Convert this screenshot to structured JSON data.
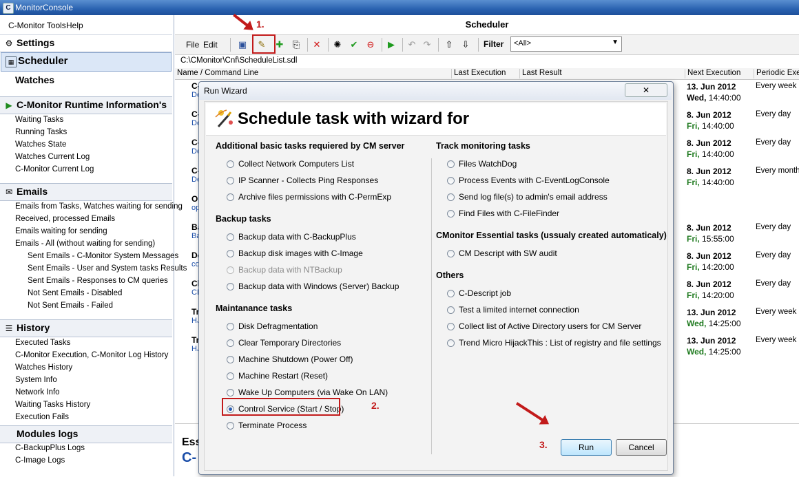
{
  "window": {
    "title": "MonitorConsole"
  },
  "menu": {
    "tools": "C-Monitor Tools",
    "help": "Help"
  },
  "sidebar": {
    "settings": "Settings",
    "scheduler": "Scheduler",
    "watches": "Watches",
    "runtime_header": "C-Monitor Runtime Information's",
    "runtime_items": [
      "Waiting Tasks",
      "Running Tasks",
      "Watches State",
      "Watches Current Log",
      "C-Monitor Current Log"
    ],
    "emails_header": "Emails",
    "emails_items": [
      "Emails from Tasks, Watches waiting for sending",
      "Received, processed Emails",
      "Emails waiting for sending",
      "Emails - All (without waiting for sending)"
    ],
    "emails_sub": [
      "Sent Emails - C-Monitor System Messages",
      "Sent Emails - User and System tasks Results",
      "Sent Emails - Responses to CM queries",
      "Not Sent Emails - Disabled",
      "Not Sent Emails - Failed"
    ],
    "history_header": "History",
    "history_items": [
      "Executed Tasks",
      "C-Monitor Execution, C-Monitor Log History",
      "Watches History",
      "System Info",
      "Network Info",
      "Waiting Tasks History",
      "Execution Fails"
    ],
    "modules_header": "Modules logs",
    "modules_items": [
      "C-BackupPlus Logs",
      "C-Image Logs"
    ]
  },
  "scheduler": {
    "header": "Scheduler",
    "file_menu": "File",
    "edit_menu": "Edit",
    "filter_label": "Filter",
    "filter_value": "<All>",
    "path": "C:\\CMonitor\\Cnf\\ScheduleList.sdl",
    "columns": [
      "Name / Command Line",
      "Last Execution",
      "Last Result",
      "Next Execution",
      "Periodic Exec"
    ],
    "rows": [
      {
        "n1": "C-",
        "n2": "De",
        "next_date": "13. Jun 2012",
        "next_day": "Wed,",
        "next_time": "14:40:00",
        "periodic": "Every week in"
      },
      {
        "n1": "C-",
        "n2": "De",
        "next_date": "8. Jun 2012",
        "next_day": "Fri,",
        "next_time": "14:40:00",
        "periodic": "Every day"
      },
      {
        "n1": "C-",
        "n2": "De",
        "next_date": "8. Jun 2012",
        "next_day": "Fri,",
        "next_time": "14:40:00",
        "periodic": "Every day"
      },
      {
        "n1": "C-",
        "n2": "De",
        "next_date": "8. Jun 2012",
        "next_day": "Fri,",
        "next_time": "14:40:00",
        "periodic": "Every month"
      },
      {
        "n1": "Op",
        "n2": "op",
        "next_date": "",
        "next_day": "",
        "next_time": "",
        "periodic": ""
      },
      {
        "n1": "Ba",
        "n2": "Ba",
        "next_date": "8. Jun 2012",
        "next_day": "Fri,",
        "next_time": "15:55:00",
        "periodic": "Every day"
      },
      {
        "n1": "De",
        "n2": "co",
        "next_date": "8. Jun 2012",
        "next_day": "Fri,",
        "next_time": "14:20:00",
        "periodic": "Every day"
      },
      {
        "n1": "Cl",
        "n2": "CL",
        "next_date": "8. Jun 2012",
        "next_day": "Fri,",
        "next_time": "14:20:00",
        "periodic": "Every day"
      },
      {
        "n1": "Tr",
        "n2": "HJ",
        "next_date": "13. Jun 2012",
        "next_day": "Wed,",
        "next_time": "14:25:00",
        "periodic": "Every week in"
      },
      {
        "n1": "Tr",
        "n2": "HJ",
        "next_date": "13. Jun 2012",
        "next_day": "Wed,",
        "next_time": "14:25:00",
        "periodic": "Every week in"
      }
    ],
    "bottom_title": "Ess",
    "bottom_sub": "C-"
  },
  "dialog": {
    "title": "Run Wizard",
    "heading": "Schedule task with wizard for",
    "left_groups": [
      {
        "title": "Additional basic tasks requiered by CM server",
        "options": [
          "Collect Network Computers List",
          "IP Scanner - Collects Ping Responses",
          "Archive files permissions with C-PermExp"
        ]
      },
      {
        "title": "Backup tasks",
        "options": [
          "Backup data with C-BackupPlus",
          "Backup disk images with C-Image",
          "Backup data with NTBackup",
          "Backup data with Windows (Server) Backup"
        ]
      },
      {
        "title": "Maintanance tasks",
        "options": [
          "Disk Defragmentation",
          "Clear Temporary Directories",
          "Machine Shutdown (Power Off)",
          "Machine Restart (Reset)",
          "Wake Up Computers (via Wake On LAN)",
          "Control Service (Start / Stop)",
          "Terminate Process"
        ]
      }
    ],
    "right_groups": [
      {
        "title": "Track monitoring tasks",
        "options": [
          "Files WatchDog",
          "Process Events with C-EventLogConsole",
          "Send log file(s) to admin's email address",
          "Find Files with C-FileFinder"
        ]
      },
      {
        "title": "CMonitor Essential tasks (ussualy created automaticaly)",
        "options": [
          "CM Descript with SW audit"
        ]
      },
      {
        "title": "Others",
        "options": [
          "C-Descript job",
          "Test a limited internet connection",
          "Collect list of Active Directory users for CM Server",
          "Trend Micro HijackThis : List of registry and file settings"
        ]
      }
    ],
    "selected_option": "Control Service (Start / Stop)",
    "disabled_option": "Backup data with NTBackup",
    "run_label": "Run",
    "cancel_label": "Cancel",
    "close_glyph": "✕"
  },
  "annotations": {
    "step1": "1.",
    "step2": "2.",
    "step3": "3."
  },
  "colors": {
    "accent": "#c21a1a",
    "link": "#1a4da8",
    "day_green": "#1f7a1f"
  }
}
